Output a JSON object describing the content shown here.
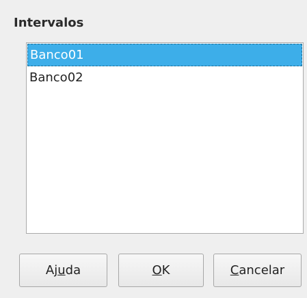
{
  "section": {
    "title": "Intervalos"
  },
  "list": {
    "items": [
      {
        "label": "Banco01",
        "selected": true
      },
      {
        "label": "Banco02",
        "selected": false
      }
    ]
  },
  "buttons": {
    "help": {
      "before": "Aj",
      "mnemonic": "u",
      "after": "da"
    },
    "ok": {
      "before": "",
      "mnemonic": "O",
      "after": "K"
    },
    "cancel": {
      "before": "",
      "mnemonic": "C",
      "after": "ancelar"
    }
  },
  "colors": {
    "selection": "#3daee9",
    "background": "#efefef"
  }
}
